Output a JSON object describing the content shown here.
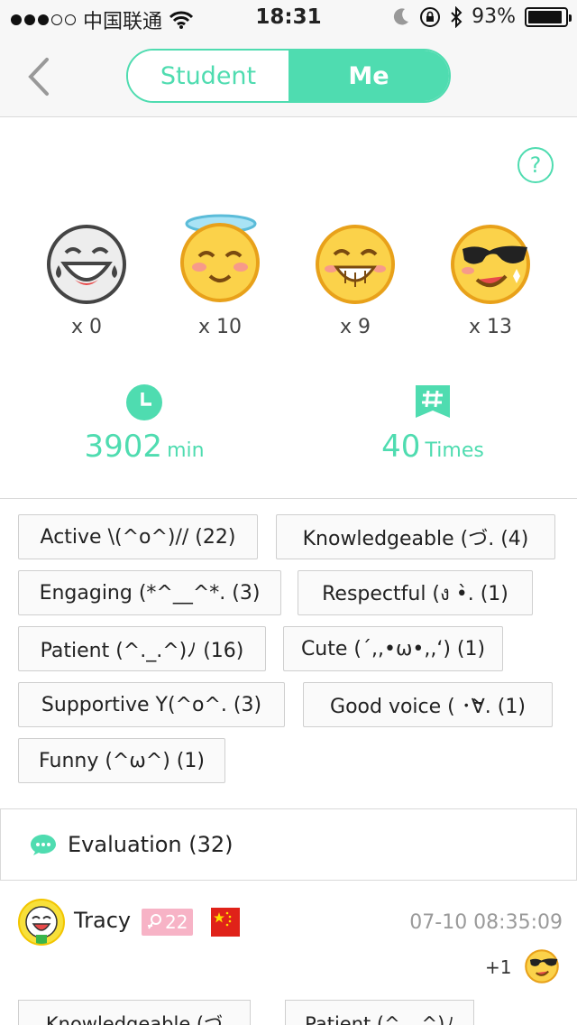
{
  "status_bar": {
    "carrier": "中国联通",
    "time": "18:31",
    "battery": "93%",
    "battery_level": 0.93
  },
  "nav": {
    "tabs": [
      {
        "label": "Student",
        "active": false
      },
      {
        "label": "Me",
        "active": true
      }
    ]
  },
  "help": {
    "label": "?"
  },
  "emojis": [
    {
      "icon": "laughing-tears-icon",
      "count": "x 0"
    },
    {
      "icon": "angel-smile-icon",
      "count": "x 10"
    },
    {
      "icon": "grin-icon",
      "count": "x 9"
    },
    {
      "icon": "sunglasses-icon",
      "count": "x 13"
    }
  ],
  "stats": {
    "minutes": {
      "value": "3902",
      "unit": "min",
      "icon": "clock-icon"
    },
    "times": {
      "value": "40",
      "unit": "Times",
      "icon": "hashtag-icon"
    }
  },
  "tags": [
    "Active \\(^o^)// (22)",
    "Knowledgeable (づ. (4)",
    "Engaging (*^__^*. (3)",
    "Respectful (ง •̀. (1)",
    "Patient (^._.^)ﾉ (16)",
    "Cute (´,,•ω•,,‘) (1)",
    "Supportive Y(^o^. (3)",
    "Good voice ( ･̀∀. (1)",
    "Funny (^ω^) (1)"
  ],
  "evaluation": {
    "label": "Evaluation (32)",
    "icon": "chat-bubble-icon"
  },
  "review": {
    "name": "Tracy",
    "badge": "22",
    "time": "07-10 08:35:09",
    "plus": "+1",
    "tags": [
      "Knowledgeable (づ",
      "Patient (^._.^)ﾉ"
    ]
  },
  "colors": {
    "accent": "#4fdcb0",
    "badge": "#f7b3c6",
    "flag": "#e02219"
  }
}
